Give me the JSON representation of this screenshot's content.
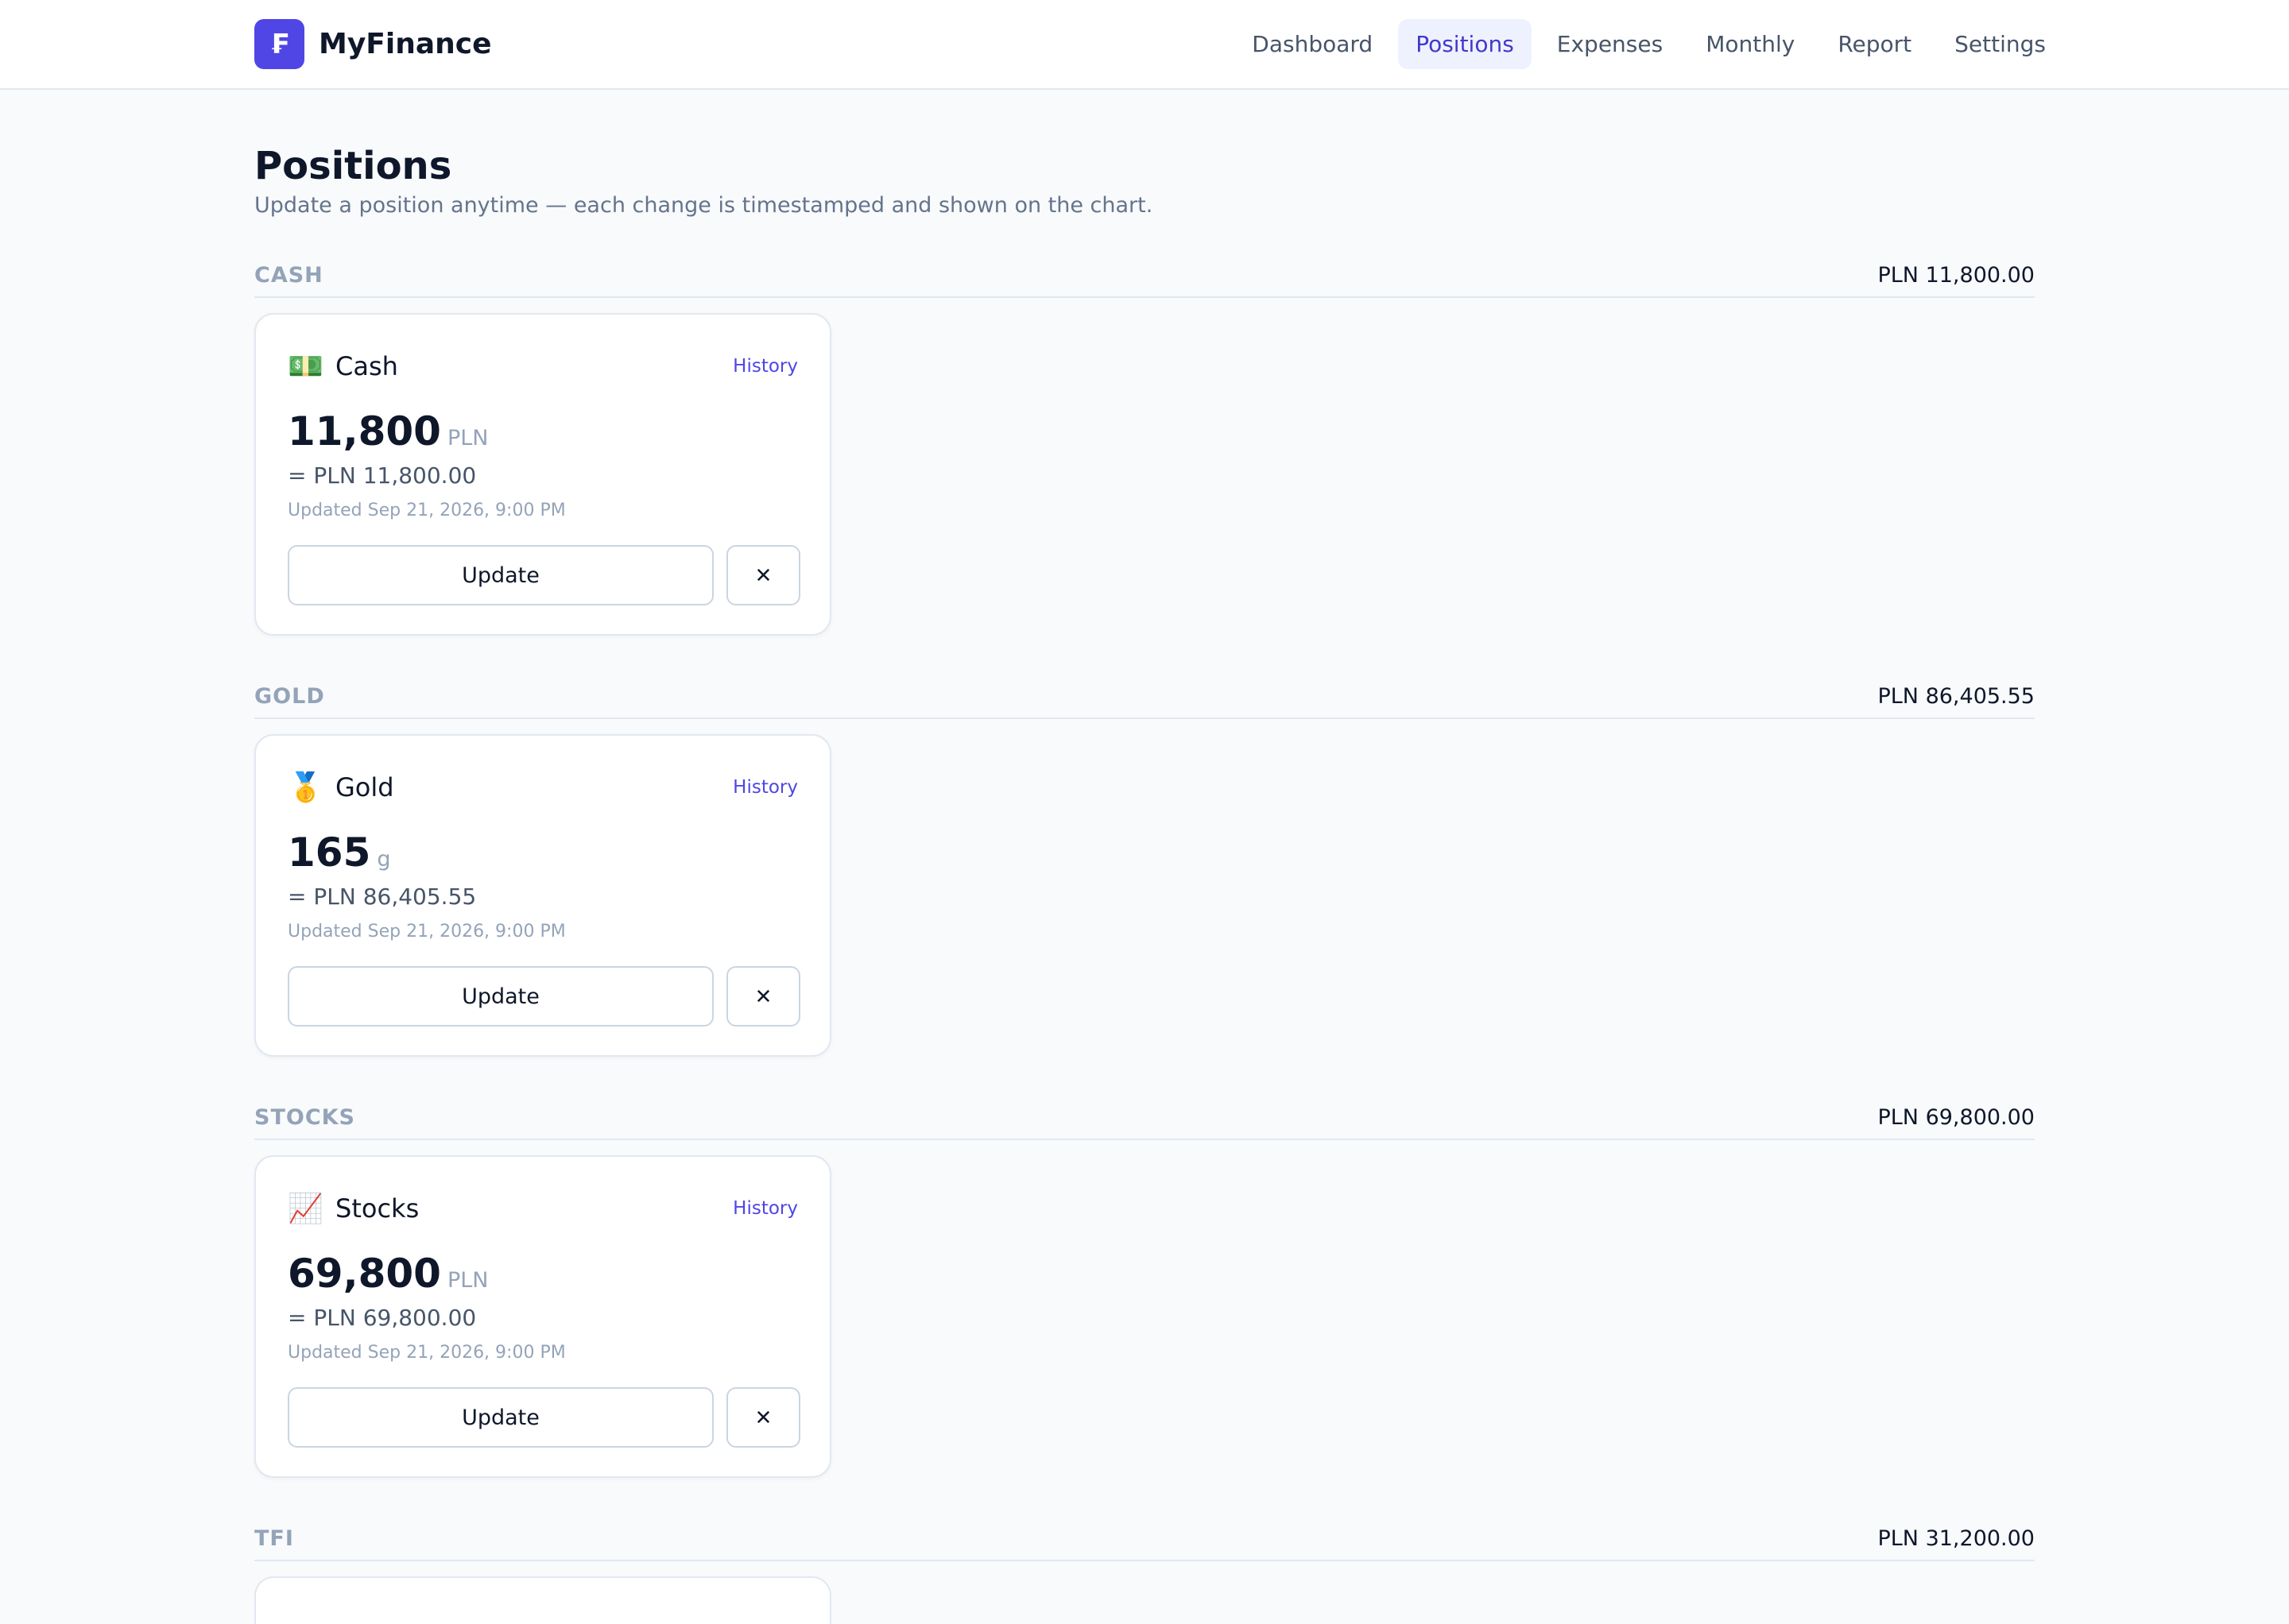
{
  "app": {
    "logo_glyph": "₣",
    "name": "MyFinance",
    "accent_color": "#4f46e5"
  },
  "nav": {
    "items": [
      {
        "label": "Dashboard",
        "active": false
      },
      {
        "label": "Positions",
        "active": true
      },
      {
        "label": "Expenses",
        "active": false
      },
      {
        "label": "Monthly",
        "active": false
      },
      {
        "label": "Report",
        "active": false
      },
      {
        "label": "Settings",
        "active": false
      }
    ]
  },
  "page": {
    "title": "Positions",
    "subtitle": "Update a position anytime — each change is timestamped and shown on the chart."
  },
  "sections": [
    {
      "name": "CASH",
      "total": "PLN 11,800.00",
      "card": {
        "icon": "💵",
        "icon_name": "banknote-icon",
        "name": "Cash",
        "history_label": "History",
        "amount": "11,800",
        "unit": "PLN",
        "converted": "= PLN 11,800.00",
        "updated": "Updated Sep 21, 2026, 9:00 PM",
        "update_label": "Update",
        "remove_label": "✕"
      }
    },
    {
      "name": "GOLD",
      "total": "PLN 86,405.55",
      "card": {
        "icon": "🥇",
        "icon_name": "gold-medal-icon",
        "name": "Gold",
        "history_label": "History",
        "amount": "165",
        "unit": "g",
        "converted": "= PLN 86,405.55",
        "updated": "Updated Sep 21, 2026, 9:00 PM",
        "update_label": "Update",
        "remove_label": "✕"
      }
    },
    {
      "name": "STOCKS",
      "total": "PLN 69,800.00",
      "card": {
        "icon": "📈",
        "icon_name": "chart-increasing-icon",
        "name": "Stocks",
        "history_label": "History",
        "amount": "69,800",
        "unit": "PLN",
        "converted": "= PLN 69,800.00",
        "updated": "Updated Sep 21, 2026, 9:00 PM",
        "update_label": "Update",
        "remove_label": "✕"
      }
    },
    {
      "name": "TFI",
      "total": "PLN 31,200.00"
    }
  ]
}
